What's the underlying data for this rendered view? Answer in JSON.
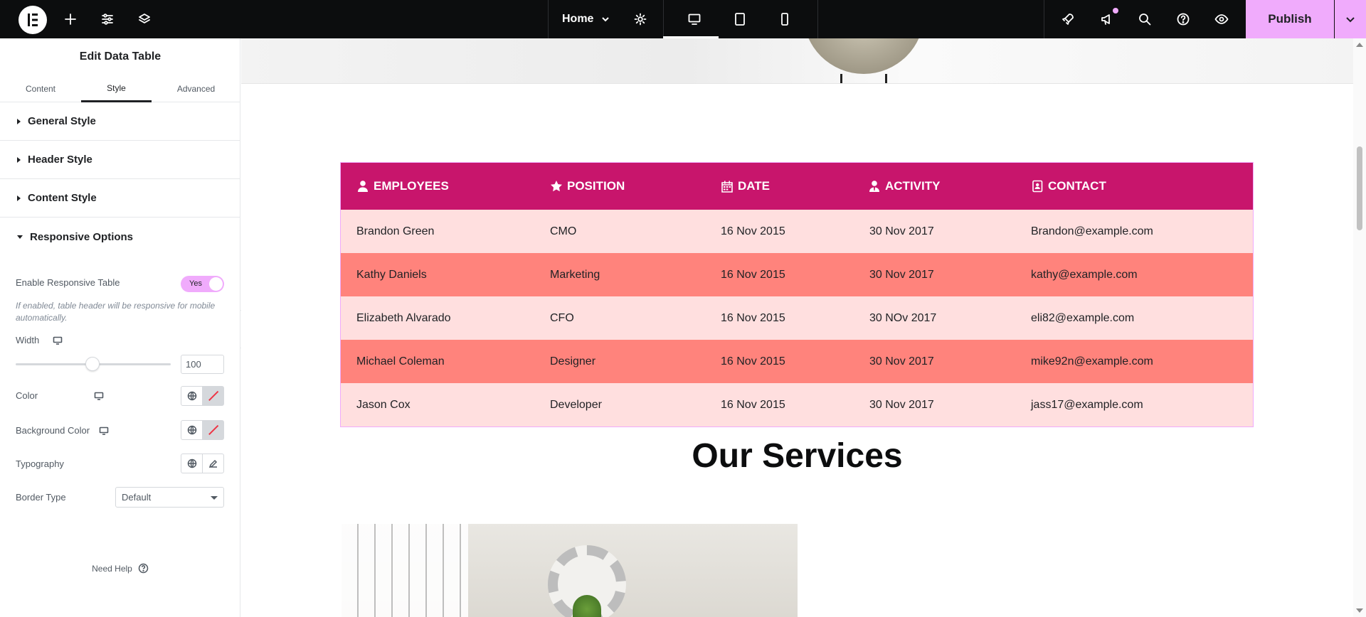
{
  "topbar": {
    "page_name": "Home",
    "publish_label": "Publish",
    "icons": [
      "elementor-logo-icon",
      "plus-icon",
      "sliders-icon",
      "layers-icon",
      "chevron-down-icon",
      "gear-icon",
      "desktop-icon",
      "tablet-icon",
      "mobile-icon",
      "rocket-icon",
      "megaphone-icon",
      "search-icon",
      "help-icon",
      "eye-icon"
    ]
  },
  "panel": {
    "title": "Edit Data Table",
    "tabs": [
      {
        "label": "Content"
      },
      {
        "label": "Style"
      },
      {
        "label": "Advanced"
      }
    ],
    "sections": [
      {
        "label": "General Style"
      },
      {
        "label": "Header Style"
      },
      {
        "label": "Content Style"
      },
      {
        "label": "Responsive Options"
      }
    ],
    "enable_responsive_label": "Enable Responsive Table",
    "enable_responsive_value": "Yes",
    "help_text": "If enabled, table header will be responsive for mobile automatically.",
    "width_label": "Width",
    "width_value": "100",
    "color_label": "Color",
    "bg_color_label": "Background Color",
    "typography_label": "Typography",
    "border_type_label": "Border Type",
    "border_type_value": "Default",
    "need_help": "Need Help"
  },
  "table": {
    "headers": [
      {
        "label": "EMPLOYEES",
        "icon": "user-icon"
      },
      {
        "label": "POSITION",
        "icon": "star-icon"
      },
      {
        "label": "DATE",
        "icon": "calendar-icon"
      },
      {
        "label": "ACTIVITY",
        "icon": "user-tie-icon"
      },
      {
        "label": "CONTACT",
        "icon": "contact-book-icon"
      }
    ],
    "rows": [
      [
        "Brandon Green",
        "CMO",
        "16 Nov 2015",
        "30 Nov 2017",
        "Brandon@example.com"
      ],
      [
        "Kathy Daniels",
        "Marketing",
        "16 Nov 2015",
        "30 Nov 2017",
        "kathy@example.com"
      ],
      [
        "Elizabeth Alvarado",
        "CFO",
        "16 Nov 2015",
        "30 NOv 2017",
        "eli82@example.com"
      ],
      [
        "Michael Coleman",
        "Designer",
        "16 Nov 2015",
        "30 Nov 2017",
        "mike92n@example.com"
      ],
      [
        "Jason Cox",
        "Developer",
        "16 Nov 2015",
        "30 Nov 2017",
        "jass17@example.com"
      ]
    ]
  },
  "services_title": "Our Services",
  "colors": {
    "header_bg": "#c8156c",
    "row_light": "#ffdfdf",
    "row_dark": "#ff837c",
    "accent": "#f0abfc",
    "topbar_bg": "#0c0d0e"
  }
}
